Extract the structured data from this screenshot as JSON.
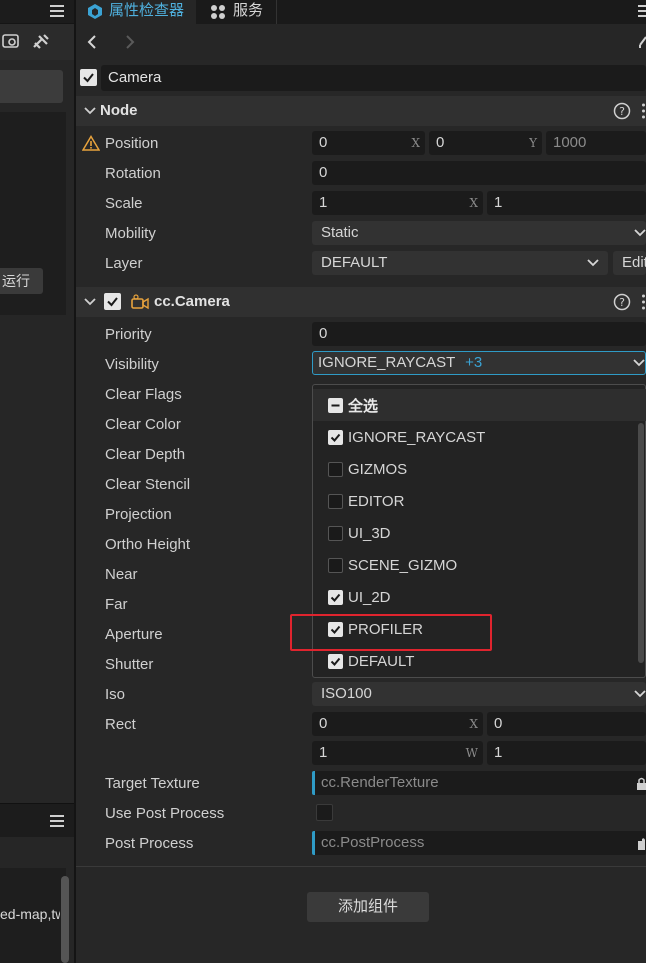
{
  "left_panel": {
    "run_button": "运行",
    "file_item": "ed-map,tw"
  },
  "tabs": [
    {
      "label": "属性检查器",
      "icon": "inspector-icon",
      "active": true
    },
    {
      "label": "服务",
      "icon": "grid-icon",
      "active": false
    }
  ],
  "node_name": "Camera",
  "node_section": {
    "title": "Node",
    "position": {
      "label": "Position",
      "x": "0",
      "x_axis": "X",
      "y": "0",
      "y_axis": "Y",
      "z": "1000"
    },
    "rotation": {
      "label": "Rotation",
      "value": "0"
    },
    "scale": {
      "label": "Scale",
      "x": "1",
      "x_axis": "X",
      "y": "1"
    },
    "mobility": {
      "label": "Mobility",
      "value": "Static"
    },
    "layer": {
      "label": "Layer",
      "value": "DEFAULT",
      "edit_label": "Edit"
    }
  },
  "camera_section": {
    "title": "cc.Camera",
    "priority": {
      "label": "Priority",
      "value": "0"
    },
    "visibility": {
      "label": "Visibility",
      "value": "IGNORE_RAYCAST",
      "extra": "+3"
    },
    "labels": {
      "clear_flags": "Clear Flags",
      "clear_color": "Clear Color",
      "clear_depth": "Clear Depth",
      "clear_stencil": "Clear Stencil",
      "projection": "Projection",
      "ortho_height": "Ortho Height",
      "near": "Near",
      "far": "Far",
      "aperture": "Aperture",
      "shutter": "Shutter"
    },
    "iso": {
      "label": "Iso",
      "value": "ISO100"
    },
    "rect": {
      "label": "Rect",
      "x": "0",
      "x_axis": "X",
      "y": "0",
      "w": "1",
      "w_axis": "W",
      "h": "1"
    },
    "target_texture": {
      "label": "Target Texture",
      "placeholder": "cc.RenderTexture"
    },
    "use_post_process": {
      "label": "Use Post Process",
      "checked": false
    },
    "post_process": {
      "label": "Post Process",
      "placeholder": "cc.PostProcess"
    }
  },
  "dropdown": {
    "select_all": "全选",
    "items": [
      {
        "label": "IGNORE_RAYCAST",
        "checked": true
      },
      {
        "label": "GIZMOS",
        "checked": false
      },
      {
        "label": "EDITOR",
        "checked": false
      },
      {
        "label": "UI_3D",
        "checked": false
      },
      {
        "label": "SCENE_GIZMO",
        "checked": false
      },
      {
        "label": "UI_2D",
        "checked": true
      },
      {
        "label": "PROFILER",
        "checked": true
      },
      {
        "label": "DEFAULT",
        "checked": true
      }
    ]
  },
  "add_component_button": "添加组件",
  "colors": {
    "accent": "#2f9bc6",
    "highlight": "#e0242e",
    "warning": "#e8a33d",
    "component_icon": "#e8a33d"
  }
}
